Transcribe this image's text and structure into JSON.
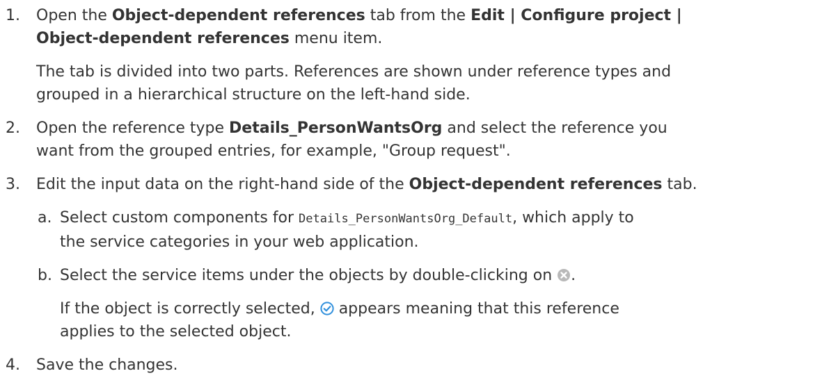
{
  "steps": [
    {
      "number": "1.",
      "line1_pre": "Open the ",
      "line1_b1": "Object-dependent references",
      "line1_mid": " tab from the ",
      "line1_b2": "Edit | Configure project |",
      "line2_b": "Object-dependent references",
      "line2_post": " menu item.",
      "note_line1": "The tab is divided into two parts. References are shown under reference types and",
      "note_line2": "grouped in a hierarchical structure on the left-hand side."
    },
    {
      "number": "2.",
      "line1_pre": "Open the reference type ",
      "line1_b": "Details_PersonWantsOrg",
      "line1_post": " and select the reference you",
      "line2": "want from the grouped entries, for example, \"Group request\"."
    },
    {
      "number": "3.",
      "line1_pre": "Edit the input data on the right-hand side of the ",
      "line1_b": "Object-dependent references",
      "line1_post": " tab.",
      "substeps": [
        {
          "letter": "a.",
          "line1_pre": "Select custom components for ",
          "line1_code": "Details_PersonWantsOrg_Default",
          "line1_post": ", which apply to",
          "line2": "the service categories in your web application."
        },
        {
          "letter": "b.",
          "line1_pre": "Select the service items under the objects by double-clicking on ",
          "line1_post": ".",
          "icon_name": "remove-circle-icon",
          "note_line1_pre": "If the object is correctly selected, ",
          "note_line1_post": " appears meaning that this reference",
          "note_icon_name": "checkmark-circle-icon",
          "note_line2": "applies to the selected object."
        }
      ]
    },
    {
      "number": "4.",
      "text": "Save the changes."
    }
  ],
  "colors": {
    "text": "#333333",
    "remove_icon": "#b9b9b9",
    "check_icon": "#2f8fdc"
  }
}
